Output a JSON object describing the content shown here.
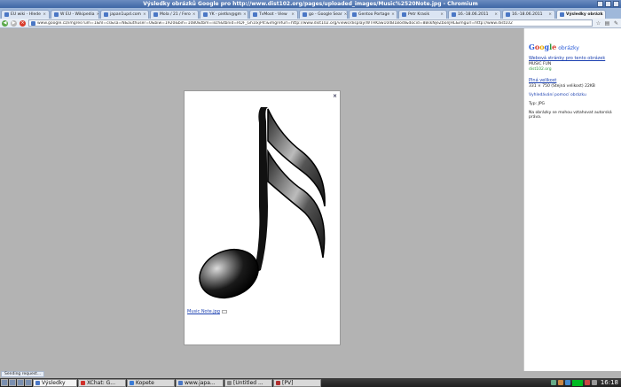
{
  "window": {
    "title": "Výsledky obrázků Google pro http://www.dist102.org/pages/uploaded_images/Music%2520Note.jpg - Chromium"
  },
  "tabs": [
    {
      "label": "EU wiki - Hlede",
      "active": false
    },
    {
      "label": "W EU - Wikipedia",
      "active": false
    },
    {
      "label": "japan1upd.com",
      "active": false
    },
    {
      "label": "Mola / 21 / Fero",
      "active": false
    },
    {
      "label": "YK - piet­kn@gm",
      "active": false
    },
    {
      "label": "TvMoot - View",
      "active": false
    },
    {
      "label": "go - Google Sear",
      "active": false
    },
    {
      "label": "Gentoo Portage",
      "active": false
    },
    {
      "label": "Petr Krasik",
      "active": false
    },
    {
      "label": "16.-18.06.2011",
      "active": false
    },
    {
      "label": "16.-18.06.2011",
      "active": false
    },
    {
      "label": "Výsledky obrázk",
      "active": true
    }
  ],
  "toolbar": {
    "url": "www.google.cz/imgres?um=1&hl=cs&sa=N&authuser=0&biw=1920&bih=1080&tbm=isch&tbnid=RDF_Gh1IxjPit:&imgrefurl=http://www.dist102.org/views/display/WTHKaw10dB1Bodl&docid=8BskNjeZbonJHL&imgurl=http://www.dist102"
  },
  "lightbox": {
    "close_label": "×",
    "image_link": "Music Note.jpg"
  },
  "panel": {
    "logo_letters": [
      "G",
      "o",
      "o",
      "g",
      "l",
      "e"
    ],
    "logo_suffix": "obrázky",
    "page_link": "Webová stránky pro tento obrázek",
    "page_title": "MUSIC FUN",
    "page_domain": "dist102.org",
    "full_size_link": "Plná velikost",
    "dimensions": "331 × 750 (Stejná velikost) 22KB",
    "search_by_image": "Vyhledávání pomocí obrázku",
    "type_line": "Typ:   JPG",
    "copyright_note": "Na obrázky se mohou vztahovat autorská práva."
  },
  "status": {
    "text": "Sending request..."
  },
  "taskbar": {
    "tasks": [
      {
        "label": "Výsledky",
        "icon_color": "#4a77c5",
        "active": true
      },
      {
        "label": "XChat: G...",
        "icon_color": "#d0302a",
        "active": false
      },
      {
        "label": "Kopete",
        "icon_color": "#3a7bd5",
        "active": false
      },
      {
        "label": "www.japa...",
        "icon_color": "#4a77c5",
        "active": false
      },
      {
        "label": "[Untitled ...",
        "icon_color": "#888888",
        "active": false
      },
      {
        "label": "[PV] ",
        "icon_color": "#b03030",
        "active": false
      }
    ],
    "clock": "16:18"
  },
  "colors": {
    "titlebar": "#3f67a6",
    "content_bg": "#b3b3b3",
    "link": "#1a3fb0"
  },
  "icons": [
    "back-icon",
    "forward-icon",
    "stop-icon",
    "star-icon",
    "page-icon",
    "wrench-icon",
    "close-icon",
    "start-menu-icon"
  ]
}
